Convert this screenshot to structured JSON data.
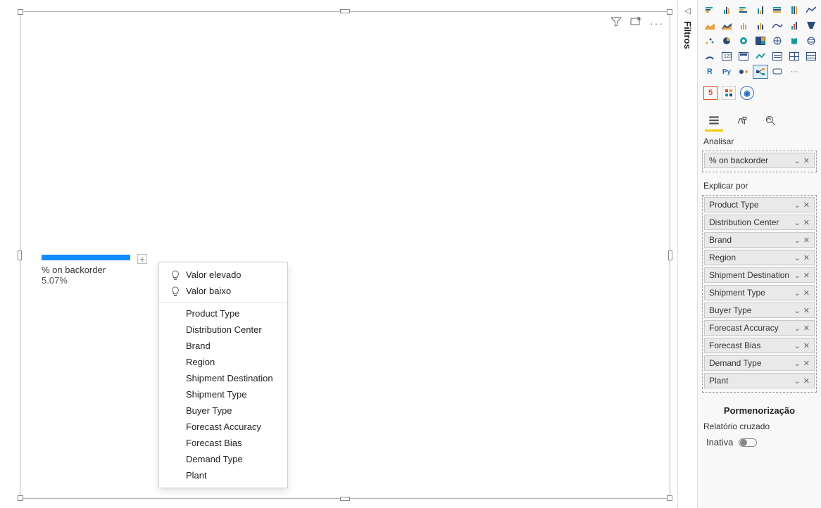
{
  "filters_tab_label": "Filtros",
  "kpi": {
    "label": "% on backorder",
    "value": "5.07%"
  },
  "popup": {
    "high": "Valor elevado",
    "low": "Valor baixo",
    "items": [
      "Product Type",
      "Distribution Center",
      "Brand",
      "Region",
      "Shipment Destination",
      "Shipment Type",
      "Buyer Type",
      "Forecast Accuracy",
      "Forecast Bias",
      "Demand Type",
      "Plant"
    ]
  },
  "pane": {
    "analyze_label": "Analisar",
    "analyze_field": "% on backorder",
    "explain_label": "Explicar por",
    "explain_fields": [
      "Product Type",
      "Distribution Center",
      "Brand",
      "Region",
      "Shipment Destination",
      "Shipment Type",
      "Buyer Type",
      "Forecast Accuracy",
      "Forecast Bias",
      "Demand Type",
      "Plant"
    ],
    "drill_header": "Pormenorização",
    "cross_report": "Relatório cruzado",
    "toggle_label": "Inativa"
  },
  "custom_visuals": {
    "html5": "5",
    "r": "R",
    "py": "Py"
  },
  "chart_data": {
    "type": "bar",
    "title": "% on backorder",
    "categories": [
      "% on backorder"
    ],
    "values": [
      5.07
    ],
    "ylabel": "",
    "xlabel": "",
    "ylim": [
      0,
      100
    ]
  }
}
